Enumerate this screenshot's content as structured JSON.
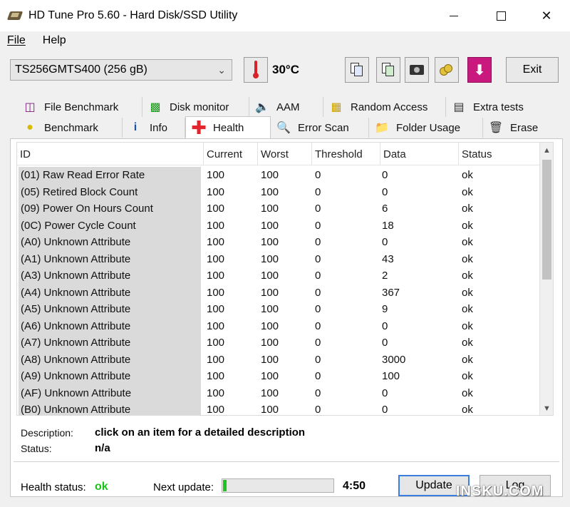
{
  "window": {
    "title": "HD Tune Pro 5.60 - Hard Disk/SSD Utility",
    "minimize_glyph": "",
    "close_glyph": "✕"
  },
  "menu": {
    "file": "File",
    "help": "Help"
  },
  "toolbar": {
    "drive": "TS256GMTS400 (256 gB)",
    "temperature": "30°C",
    "exit_label": "Exit",
    "icons": [
      "copy-text-icon",
      "copy-screenshot-icon",
      "camera-icon",
      "coins-icon",
      "save-download-icon"
    ]
  },
  "tabs": {
    "row1": [
      {
        "label": "File Benchmark",
        "icon": "file-benchmark-icon"
      },
      {
        "label": "Disk monitor",
        "icon": "disk-monitor-icon"
      },
      {
        "label": "AAM",
        "icon": "speaker-icon"
      },
      {
        "label": "Random Access",
        "icon": "random-access-icon"
      },
      {
        "label": "Extra tests",
        "icon": "extra-tests-icon"
      }
    ],
    "row2": [
      {
        "label": "Benchmark",
        "icon": "lightbulb-icon"
      },
      {
        "label": "Info",
        "icon": "info-icon"
      },
      {
        "label": "Health",
        "icon": "health-cross-icon",
        "active": true
      },
      {
        "label": "Error Scan",
        "icon": "magnifier-icon"
      },
      {
        "label": "Folder Usage",
        "icon": "folder-icon"
      },
      {
        "label": "Erase",
        "icon": "trash-icon"
      }
    ]
  },
  "health": {
    "columns": [
      "ID",
      "Current",
      "Worst",
      "Threshold",
      "Data",
      "Status"
    ],
    "rows": [
      [
        "(01) Raw Read Error Rate",
        "100",
        "100",
        "0",
        "0",
        "ok"
      ],
      [
        "(05) Retired Block Count",
        "100",
        "100",
        "0",
        "0",
        "ok"
      ],
      [
        "(09) Power On Hours Count",
        "100",
        "100",
        "0",
        "6",
        "ok"
      ],
      [
        "(0C) Power Cycle Count",
        "100",
        "100",
        "0",
        "18",
        "ok"
      ],
      [
        "(A0) Unknown Attribute",
        "100",
        "100",
        "0",
        "0",
        "ok"
      ],
      [
        "(A1) Unknown Attribute",
        "100",
        "100",
        "0",
        "43",
        "ok"
      ],
      [
        "(A3) Unknown Attribute",
        "100",
        "100",
        "0",
        "2",
        "ok"
      ],
      [
        "(A4) Unknown Attribute",
        "100",
        "100",
        "0",
        "367",
        "ok"
      ],
      [
        "(A5) Unknown Attribute",
        "100",
        "100",
        "0",
        "9",
        "ok"
      ],
      [
        "(A6) Unknown Attribute",
        "100",
        "100",
        "0",
        "0",
        "ok"
      ],
      [
        "(A7) Unknown Attribute",
        "100",
        "100",
        "0",
        "0",
        "ok"
      ],
      [
        "(A8) Unknown Attribute",
        "100",
        "100",
        "0",
        "3000",
        "ok"
      ],
      [
        "(A9) Unknown Attribute",
        "100",
        "100",
        "0",
        "100",
        "ok"
      ],
      [
        "(AF) Unknown Attribute",
        "100",
        "100",
        "0",
        "0",
        "ok"
      ],
      [
        "(B0) Unknown Attribute",
        "100",
        "100",
        "0",
        "0",
        "ok"
      ]
    ],
    "description_label": "Description:",
    "description_value": "click on an item for a detailed description",
    "status_label": "Status:",
    "status_value": "n/a",
    "health_status_label": "Health status:",
    "health_status_value": "ok",
    "next_update_label": "Next update:",
    "next_update_progress": 0.03,
    "next_update_time": "4:50",
    "update_button": "Update",
    "log_button": "Log"
  },
  "colors": {
    "ok_green": "#19c419",
    "progress_green": "#1fc41f",
    "id_cell_bg": "#dadada",
    "update_border": "#3c7ee0"
  },
  "watermark": "INSKU.COM"
}
